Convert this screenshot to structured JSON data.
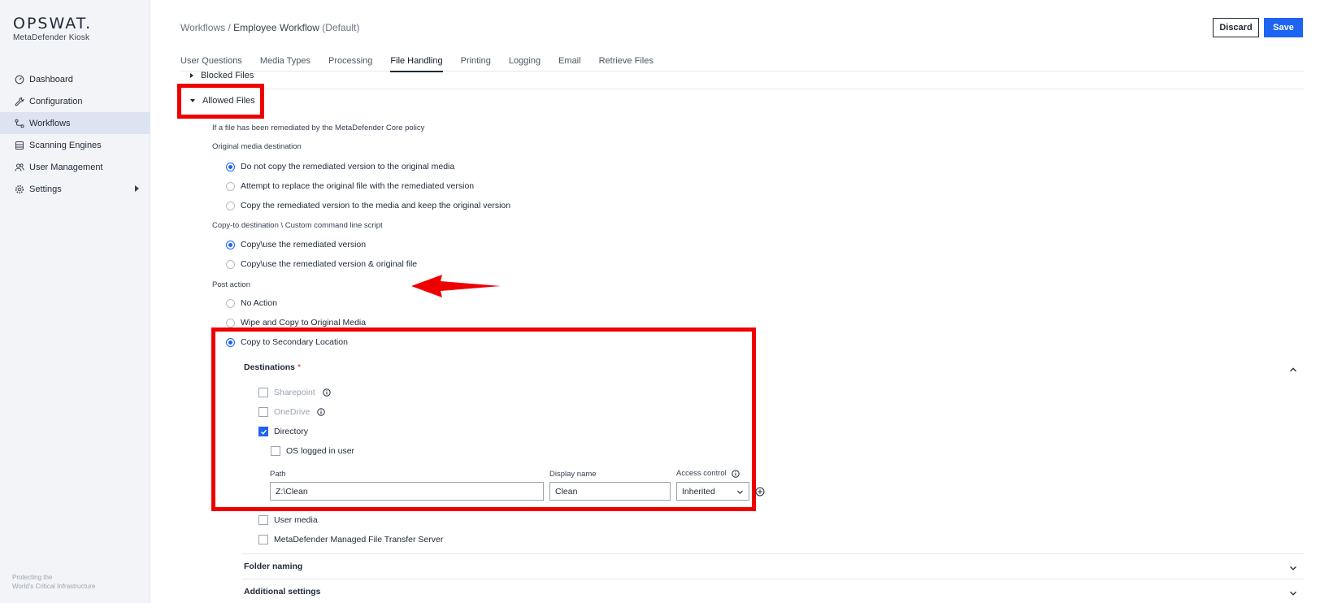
{
  "app": {
    "brand_name": "OPSWAT.",
    "product_name": "MetaDefender Kiosk",
    "footer": "Protecting the\nWorld's Critical Infrastructure"
  },
  "sidebar": {
    "items": [
      {
        "label": "Dashboard",
        "icon": "dashboard-icon"
      },
      {
        "label": "Configuration",
        "icon": "wrench-icon"
      },
      {
        "label": "Workflows",
        "icon": "workflow-icon"
      },
      {
        "label": "Scanning Engines",
        "icon": "engine-icon"
      },
      {
        "label": "User Management",
        "icon": "users-icon"
      },
      {
        "label": "Settings",
        "icon": "gear-icon"
      }
    ],
    "active": "Workflows"
  },
  "header": {
    "breadcrumb_root": "Workflows",
    "breadcrumb_sep": " / ",
    "breadcrumb_current": "Employee Workflow",
    "breadcrumb_suffix": " (Default)",
    "discard_label": "Discard",
    "save_label": "Save"
  },
  "tabs": [
    {
      "label": "User Questions"
    },
    {
      "label": "Media Types"
    },
    {
      "label": "Processing"
    },
    {
      "label": "File Handling"
    },
    {
      "label": "Printing"
    },
    {
      "label": "Logging"
    },
    {
      "label": "Email"
    },
    {
      "label": "Retrieve Files"
    }
  ],
  "active_tab": "File Handling",
  "sections": {
    "blocked_files": "Blocked Files",
    "allowed_files": "Allowed Files"
  },
  "allowed": {
    "intro": "If a file has been remediated by the MetaDefender Core policy",
    "original_media_label": "Original media destination",
    "original_media_options": [
      {
        "label": "Do not copy the remediated version to the original media",
        "selected": true
      },
      {
        "label": "Attempt to replace the original file with the remediated version",
        "selected": false
      },
      {
        "label": "Copy the remediated version to the media and keep the original version",
        "selected": false
      }
    ],
    "copy_to_label": "Copy-to destination \\ Custom command line script",
    "copy_to_options": [
      {
        "label": "Copy\\use the remediated version",
        "selected": true
      },
      {
        "label": "Copy\\use the remediated version & original file",
        "selected": false
      }
    ],
    "post_action_label": "Post action",
    "post_action_options": [
      {
        "label": "No Action",
        "selected": false
      },
      {
        "label": "Wipe and Copy to Original Media",
        "selected": false
      },
      {
        "label": "Copy to Secondary Location",
        "selected": true
      }
    ]
  },
  "destinations": {
    "title": "Destinations",
    "required_mark": "*",
    "options": [
      {
        "label": "Sharepoint",
        "checked": false,
        "disabled": true,
        "info": true
      },
      {
        "label": "OneDrive",
        "checked": false,
        "disabled": true,
        "info": true
      },
      {
        "label": "Directory",
        "checked": true,
        "disabled": false,
        "info": false
      }
    ],
    "os_logged_in": {
      "label": "OS logged in user",
      "checked": false
    },
    "path_label": "Path",
    "path_value": "Z:\\Clean",
    "display_name_label": "Display name",
    "display_name_value": "Clean",
    "access_control_label": "Access control",
    "access_control_value": "Inherited",
    "more_options": [
      {
        "label": "User media",
        "checked": false
      },
      {
        "label": "MetaDefender Managed File Transfer Server",
        "checked": false
      }
    ]
  },
  "collapsed_sections": {
    "folder_naming": "Folder naming",
    "additional_settings": "Additional settings"
  },
  "colors": {
    "accent": "#1d64f2",
    "highlight": "#ee0000",
    "sidebar_bg": "#f3f4f7"
  }
}
